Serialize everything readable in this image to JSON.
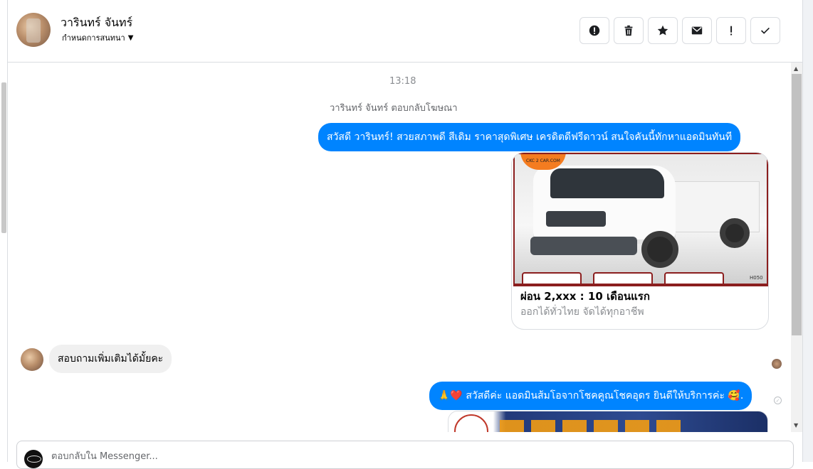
{
  "header": {
    "contact_name": "วารินทร์ จันทร์",
    "assign_label": "กำหนดการสนทนา",
    "actions": [
      {
        "icon": "alert-circle-icon",
        "label": "Mark as spam"
      },
      {
        "icon": "trash-icon",
        "label": "Delete"
      },
      {
        "icon": "star-icon",
        "label": "Star"
      },
      {
        "icon": "mail-icon",
        "label": "Mark unread"
      },
      {
        "icon": "exclamation-icon",
        "label": "Follow up"
      },
      {
        "icon": "check-icon",
        "label": "Done"
      }
    ]
  },
  "thread": {
    "timestamp": "13:18",
    "ad_reply_note": "วารินทร์ จันทร์ ตอบกลับโฆษณา",
    "messages": [
      {
        "direction": "outgoing",
        "text": "สวัสดี วารินทร์! สวยสภาพดี สีเดิม ราคาสุดพิเศษ เครดิตดีฟรีดาวน์  สนใจคันนี้ทักหาแอดมินทันที"
      },
      {
        "direction": "incoming",
        "text": "สอบถามเพิ่มเติมได้มั้ยคะ"
      },
      {
        "direction": "outgoing",
        "text": "🙏❤️ สวัสดีค่ะ แอดมินส้มโอจากโชคคูณโชคอุดร ยินดีให้บริการค่ะ 🥰."
      }
    ],
    "ad_card": {
      "title": "ผ่อน 2,xxx : 10 เดือนแรก",
      "subtitle": "ออกได้ทั่วไทย จัดได้ทุกอาชีพ",
      "image_badge": "CKC 2 CAR.COM",
      "image_code": "H050"
    }
  },
  "composer": {
    "placeholder": "ตอบกลับใน Messenger..."
  }
}
